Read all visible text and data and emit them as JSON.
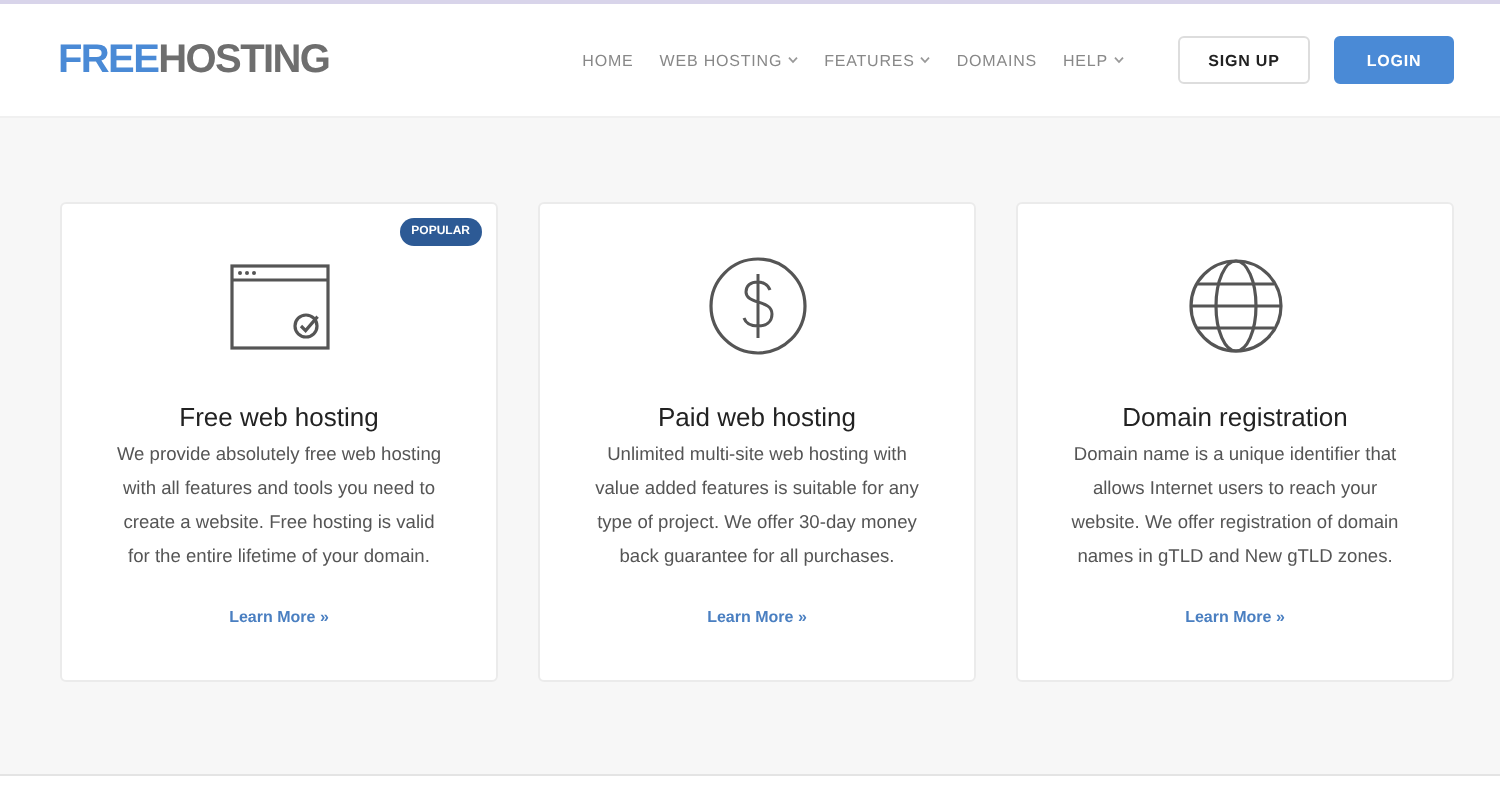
{
  "logo": {
    "first": "FREE",
    "second": "HOSTING"
  },
  "nav": [
    {
      "label": "HOME",
      "dropdown": false
    },
    {
      "label": "WEB HOSTING",
      "dropdown": true
    },
    {
      "label": "FEATURES",
      "dropdown": true
    },
    {
      "label": "DOMAINS",
      "dropdown": false
    },
    {
      "label": "HELP",
      "dropdown": true
    }
  ],
  "buttons": [
    {
      "label": "SIGN UP",
      "kind": "outline"
    },
    {
      "label": "LOGIN",
      "kind": "primary"
    }
  ],
  "cards": [
    {
      "kind": "browser",
      "badge": "POPULAR",
      "title": "Free web hosting",
      "text": "We provide absolutely free web hosting with all features and tools you need to create a website. Free hosting is valid for the entire lifetime of your domain.",
      "link": "Learn More »"
    },
    {
      "kind": "dollar",
      "title": "Paid web hosting",
      "text": "Unlimited multi-site web hosting with value added features is suitable for any type of project. We offer 30-day money back guarantee for all purchases.",
      "link": "Learn More »"
    },
    {
      "kind": "globe",
      "title": "Domain registration",
      "text": "Domain name is a unique identifier that allows Internet users to reach your website. We offer registration of domain names in gTLD and New gTLD zones.",
      "link": "Learn More »"
    }
  ]
}
